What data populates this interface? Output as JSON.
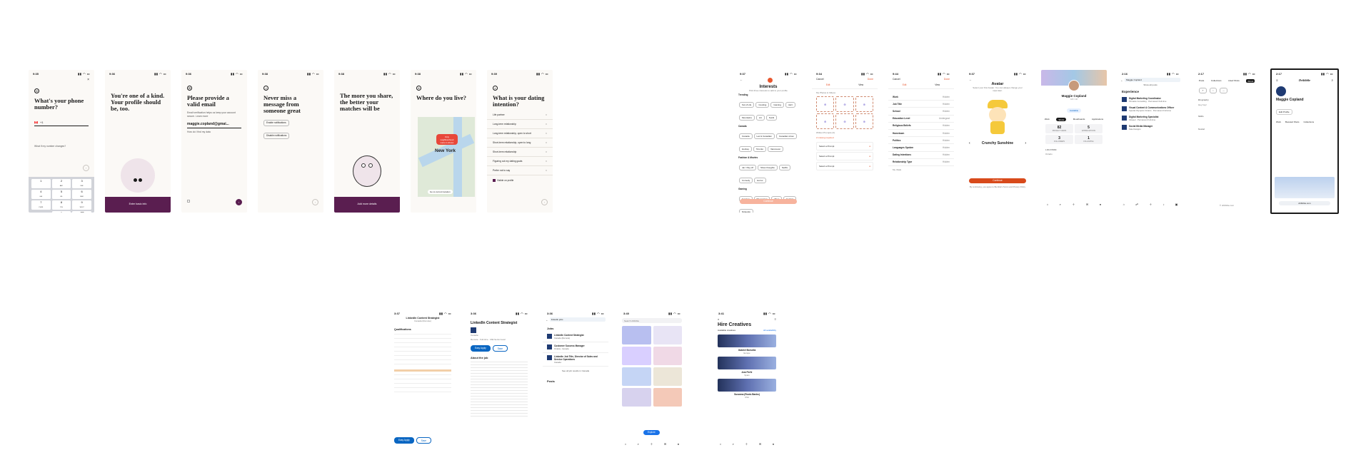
{
  "hinge": {
    "phone": {
      "time": "9:35",
      "title": "What's your phone number?",
      "country_code": "+1",
      "flag": "🇨🇦",
      "helper": "What if my number changes?",
      "keys": [
        {
          "d": "1",
          "l": ""
        },
        {
          "d": "2",
          "l": "ABC"
        },
        {
          "d": "3",
          "l": "DEF"
        },
        {
          "d": "4",
          "l": "GHI"
        },
        {
          "d": "5",
          "l": "JKL"
        },
        {
          "d": "6",
          "l": "MNO"
        },
        {
          "d": "7",
          "l": "PQRS"
        },
        {
          "d": "8",
          "l": "TUV"
        },
        {
          "d": "9",
          "l": "WXYZ"
        },
        {
          "d": "",
          "l": ""
        },
        {
          "d": "0",
          "l": ""
        },
        {
          "d": "⌫",
          "l": ""
        }
      ]
    },
    "profile": {
      "time": "9:36",
      "title": "You're one of a kind. Your profile should be, too.",
      "button": "Enter basic info"
    },
    "email": {
      "time": "9:36",
      "title": "Please provide a valid email",
      "sub": "Email verification helps us keep your account secure. Learn more",
      "value": "maggie.copland@gmai...",
      "hint": "How do I find my data"
    },
    "notify": {
      "time": "9:38",
      "title": "Never miss a message from someone great",
      "btn1": "Enable notifications",
      "btn2": "Disable notifications"
    },
    "share": {
      "time": "9:38",
      "title": "The more you share, the better your matches will be",
      "button": "Add more details"
    },
    "location": {
      "time": "9:38",
      "title": "Where do you live?",
      "city": "New York",
      "pin": "Only neighbourhood name is shown",
      "cta": "Go to current location"
    },
    "intention": {
      "time": "9:39",
      "title": "What is your dating intention?",
      "options": [
        "Life partner",
        "Long-term relationship",
        "Long-term relationship, open to short",
        "Short-term relationship, open to long",
        "Short-term relationship",
        "Figuring out my dating goals",
        "Prefer not to say"
      ],
      "visible": "Visible on profile"
    }
  },
  "bumble": {
    "interests": {
      "time": "9:37",
      "title": "Interests",
      "sub": "Pick three interests to add to your profile",
      "sections": [
        {
          "name": "Trending",
          "chips": [
            "Sol of Life",
            "Cooking",
            "Gaming",
            "Jazz",
            "Mountains",
            "Art",
            "Sushi"
          ]
        },
        {
          "name": "Canada",
          "chips": [
            "Canada",
            "Lac & Canadian",
            "Canadian show",
            "Hockey",
            "Toronto",
            "Vancouver"
          ]
        },
        {
          "name": "Fashion & Movies",
          "chips": [
            "Jar / Pay off",
            "Show thoughts",
            "Netflix",
            "Comedy",
            "Horror"
          ]
        },
        {
          "name": "Gaming",
          "chips": [
            "Gaming",
            "PC gaming",
            "Xbox",
            "Fortnite",
            "Nintendo"
          ]
        }
      ],
      "button": "Continue"
    },
    "edit_photos": {
      "time": "9:34",
      "title": "Done",
      "sub": "",
      "nav": "Cancel",
      "tab1": "Edit",
      "tab2": "View",
      "section": "My Photos & Videos",
      "prompts_title": "Written Prompts (3)",
      "prompt_placeholder": "Select a Prompt",
      "warning": "2 missing required"
    },
    "edit_info": {
      "time": "9:44",
      "rows": [
        {
          "k": "Work",
          "v": "Hidden"
        },
        {
          "k": "Job Title",
          "v": "Hidden"
        },
        {
          "k": "School",
          "v": "Hidden"
        },
        {
          "k": "Education Level",
          "v": "Undergrad"
        },
        {
          "k": "Religious Beliefs",
          "v": "Hidden"
        },
        {
          "k": "Hometown",
          "v": "Hidden"
        },
        {
          "k": "Politics",
          "v": "Hidden"
        },
        {
          "k": "Languages Spoken",
          "v": "Hidden"
        },
        {
          "k": "Dating Intentions",
          "v": "Hidden"
        },
        {
          "k": "Relationship Type",
          "v": "Hidden"
        }
      ],
      "footer": "My Vitals"
    },
    "avatar": {
      "time": "9:37",
      "title": "Avatar",
      "sub": "Select your first Avatar. You can always change your style later.",
      "name": "Crunchy Sunshine",
      "button": "Continue",
      "terms": "By continuing, you agree to Bumble's Terms and Privacy Policy"
    }
  },
  "dribbble_profile": {
    "name": "Maggie Copland",
    "title": "UX / UI",
    "badge": "Available",
    "tabs": [
      "Work",
      "Shots",
      "Moodboards",
      "Applications"
    ],
    "stats": [
      {
        "v": "82",
        "k": "PROJECT VIEWS"
      },
      {
        "v": "5",
        "k": "APPRECIATIONS"
      },
      {
        "v": "3",
        "k": "FOLLOWERS"
      },
      {
        "v": "1",
        "k": "FOLLOWING"
      }
    ],
    "location_label": "LOCATION",
    "location": "Ontario"
  },
  "linkedin_exp": {
    "time": "2:16",
    "search": "Maggie Copland",
    "all_posts": "Show all posts",
    "heading": "Experience",
    "items": [
      {
        "t": "Digital Marketing Coordinator",
        "c": "Pinnacle Consulting · Permanent Full-time"
      },
      {
        "t": "Visual Content & Communications Officer",
        "c": "Special Olympics Ontario · Permanent Full-time"
      },
      {
        "t": "Digital Marketing Specialist",
        "c": "Inkweel · Permanent Full-time"
      },
      {
        "t": "Social Media Manager",
        "c": "Kate Designs"
      }
    ]
  },
  "linkedin_about": {
    "time": "2:17",
    "tabs": [
      "Posts",
      "Collections",
      "Liked Shots",
      "About"
    ],
    "biography_label": "Biography",
    "bio": "Hey hey!",
    "skills_label": "Skills",
    "social_label": "Social",
    "footer": "© dribbble.com"
  },
  "dribbble_login": {
    "time": "2:17",
    "brand": "Dribbble",
    "name": "Maggie Copland",
    "edit_profile": "Edit Profile",
    "tabs": [
      "Work",
      "Boosted Shots",
      "Collections"
    ],
    "url": "dribbble.com"
  },
  "linkedin_job": {
    "time": "3:37",
    "header": "LinkedIn Content Strategist",
    "sub": "Canada (Remote)",
    "qualifications": "Qualifications",
    "button": "Easy Apply",
    "save": "Save"
  },
  "linkedin_job2": {
    "time": "3:36",
    "title": "LinkedIn Content Strategist",
    "company": "Canada",
    "meta": "Remote · Full-time · Mid-Senior level",
    "about": "About the job",
    "apply": "Easy Apply",
    "save": "Save"
  },
  "linkedin_search": {
    "time": "3:36",
    "search": "linkedin jobs",
    "jobs_label": "Jobs",
    "jobs": [
      {
        "t": "LinkedIn Content Strategist",
        "c": "Canada (Remote)"
      },
      {
        "t": "Customer Success Manager",
        "c": "Ontario, Canada"
      },
      {
        "t": "LinkedIn Job Title, Director of Sales and Service Operations",
        "c": "Canada"
      }
    ],
    "see_all": "See all job results in Canada",
    "posts_label": "Posts"
  },
  "dribbble_explore": {
    "time": "3:40",
    "search": "Search dribbble",
    "button": "Explore"
  },
  "hire": {
    "time": "3:41",
    "title": "Hire Creatives",
    "filter_label": "Available creatives",
    "filter_value": "All availability",
    "creatives": [
      {
        "name": "Gabriel Borsella",
        "loc": "Europe"
      },
      {
        "name": "Ana Perfe",
        "loc": "Spain"
      },
      {
        "name": "Susanna (Roots Banks)",
        "loc": "USA"
      }
    ]
  }
}
